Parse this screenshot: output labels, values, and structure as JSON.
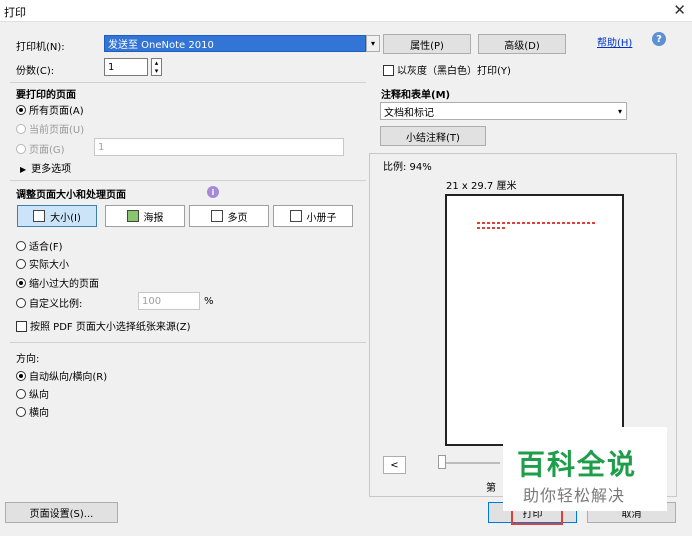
{
  "window": {
    "title": "打印",
    "close_glyph": "✕"
  },
  "printer": {
    "label": "打印机(N):",
    "selected": "发送至 OneNote 2010",
    "properties_btn": "属性(P)",
    "advanced_btn": "高级(D)",
    "help_link": "帮助(H)"
  },
  "copies": {
    "label": "份数(C):",
    "value": "1"
  },
  "grayscale": {
    "label": "以灰度（黑白色）打印(Y)"
  },
  "pages_to_print": {
    "heading": "要打印的页面",
    "all": "所有页面(A)",
    "current": "当前页面(U)",
    "pages": "页面(G)",
    "pages_value": "1",
    "more": "更多选项"
  },
  "comments": {
    "heading": "注释和表单(M)",
    "selected": "文档和标记",
    "summarize_btn": "小结注释(T)"
  },
  "sizing": {
    "heading": "调整页面大小和处理页面",
    "buttons": [
      "大小(I)",
      "海报",
      "多页",
      "小册子"
    ],
    "fit": "适合(F)",
    "actual": "实际大小",
    "shrink": "缩小过大的页面",
    "custom": "自定义比例:",
    "custom_value": "100",
    "percent": "%",
    "paper_source": "按照 PDF 页面大小选择纸张来源(Z)"
  },
  "orientation": {
    "heading": "方向:",
    "auto": "自动纵向/横向(R)",
    "portrait": "纵向",
    "landscape": "横向"
  },
  "preview": {
    "scale": "比例:  94%",
    "paper": "21 x 29.7 厘米",
    "prev_btn": "<",
    "page_partial": "第"
  },
  "bottom": {
    "page_setup_btn": "页面设置(S)...",
    "print_btn": "打印",
    "cancel_btn": "取消"
  },
  "watermark": {
    "line1": "百科全说",
    "line2": "助你轻松解决"
  },
  "colors": {
    "accent": "#3375d6",
    "highlight": "#e0403a",
    "watermark_green": "#1e9e4a"
  }
}
